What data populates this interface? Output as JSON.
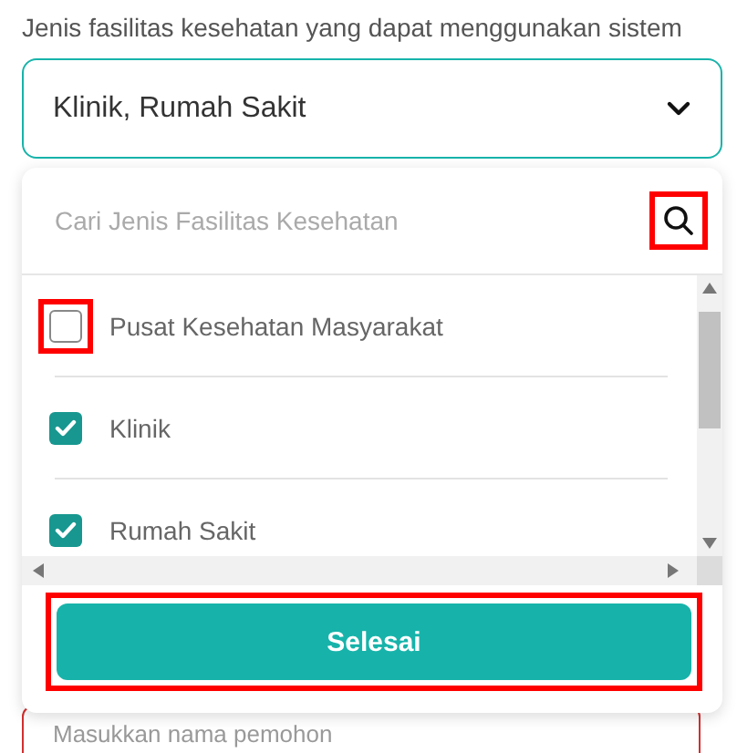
{
  "field_label": "Jenis fasilitas kesehatan yang dapat menggunakan sistem",
  "select": {
    "value": "Klinik, Rumah Sakit",
    "expanded": true
  },
  "dropdown": {
    "search": {
      "placeholder": "Cari Jenis Fasilitas Kesehatan",
      "highlighted": true
    },
    "options": [
      {
        "label": "Pusat Kesehatan Masyarakat",
        "checked": false,
        "highlighted": true
      },
      {
        "label": "Klinik",
        "checked": true,
        "highlighted": false
      },
      {
        "label": "Rumah Sakit",
        "checked": true,
        "highlighted": false
      }
    ],
    "done_button": {
      "label": "Selesai",
      "highlighted": true
    }
  },
  "next_field": {
    "placeholder": "Masukkan nama pemohon",
    "error": true
  }
}
